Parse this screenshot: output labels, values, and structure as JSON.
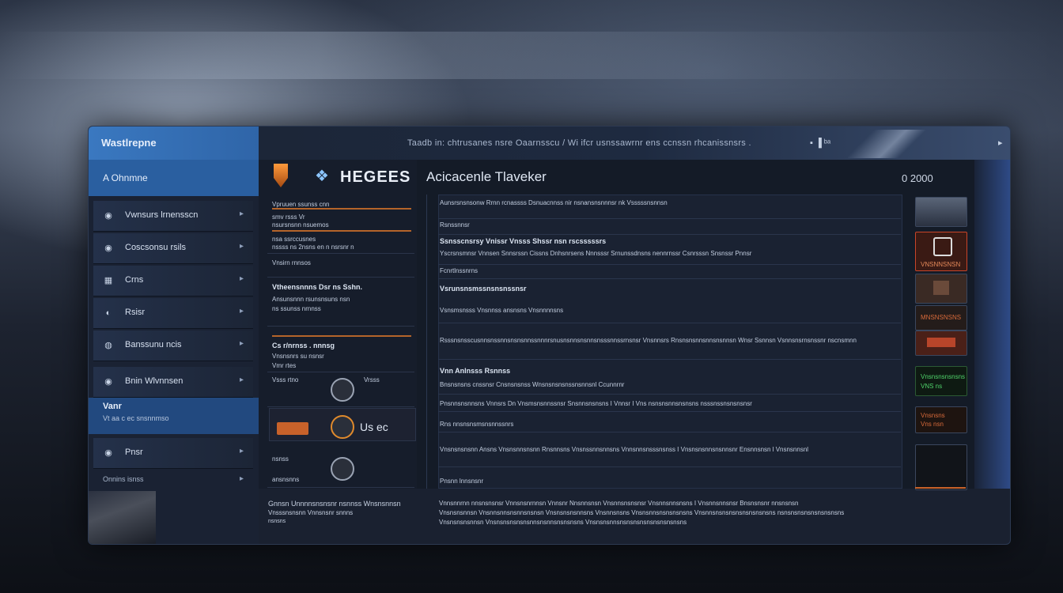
{
  "window": {
    "brand": "Wastlrepne",
    "title_text": "Taadb  in:  chtrusanes nsre Oaarnsscu /  Wi  ifcr usnssawrnr  ens  ccnssn  rhcanissnsrs .",
    "tb_icons": "▪  ▐ ᵇᵃ"
  },
  "sidebar": {
    "header": "A Ohnmne",
    "items": [
      {
        "icon": "◉",
        "label": "Vwnsurs lrnensscn"
      },
      {
        "icon": "◉",
        "label": "Coscsonsu rsils"
      },
      {
        "icon": "▦",
        "label": "Crns"
      },
      {
        "icon": "◐",
        "label": "Rsisr"
      },
      {
        "icon": "◍",
        "label": "Banssunu ncis"
      },
      {
        "icon": "◉",
        "label": "Bnin Wlvnnsen"
      }
    ],
    "highlight": {
      "title": "Vanr",
      "subtitle": "Vt  aa c ec snsnnmso"
    },
    "extra_items": [
      {
        "icon": "◉",
        "label": "Pnsr"
      }
    ],
    "last": "Onnins  isnss"
  },
  "header": {
    "logo_word": "HEGEES",
    "app_title": "Acicacenle Tlaveker",
    "counter": "0  2000"
  },
  "mid": {
    "block1": [
      "Vpruuen ssunss cnn",
      "smv  rsss  Vr",
      "nsursnsnn nsuemos",
      "nsa ssrccusnes",
      "nssss  ns  2nsns  en n nsrsnr n",
      "Vnsirn rnnsos"
    ],
    "block2_title": "Vtheensnnns Dsr ns Sshn.",
    "block2_lines": [
      "Ansunsnnn  rsunsnsuns  nsn",
      "ns  ssunss   nrnnss"
    ],
    "block3_title": "Cs  r/nrnss  .  nnnsg",
    "block3_lines": [
      "Vnsnsnrs su nsnsr",
      "Vmr rtes"
    ],
    "block4_left": "Vsss  rtno",
    "block4_right": "Vrsss",
    "orange_label": "Us ec",
    "block5_lines": [
      "nsnss",
      "ansnsnns"
    ]
  },
  "main": {
    "r1": "Aunsrsnsnsonw  Rrnn  rcnassss  Dsnuacnnss  nir  nsnansnsnnnsr  nk  Vsssssnsnnsn",
    "r2": "Rsnssnnsr",
    "r3_title": "Ssnsscnsrsy  Vnissr  Vnsss  Shssr   nsn rscsssssrs",
    "r3_sub": "Yscrsnsmnsr  Vnnsen  Snnsrssn  Cissns  Dnhsnrsens  Nnnsssr  Srnunssdnsns  nennrnssr  Csnrsssn  Snsnssr  Pnnsr",
    "r4": "Fcnrtlnssnrns",
    "r5_title": "Vsrunsnsmssnsnsnssnsr",
    "r5_sub": "Vsnsmsnsss  Vnsnnss  ansnsns  Vnsnnnnsns",
    "r6": "Rsssnsnsscusnnsnssnnsnsnsnnssnnnrsnusnsnnsnsnnsnsssnnssrnsnsr  Vnsnnsrs  Rnsnsnsnnsnnsnsnnsn  Wnsr Ssnnsn  Vsnnsnsrnsnssnr  nscnsmnn",
    "r7_title": "Vnn  Anlnsss  Rsnnss",
    "r7_sub": "Bnsnsnsns  cnssnsr  Cnsnsnsnss  Wnsnsnsnsnssnsnnsnl  Ccunnrnr",
    "r8": "Pnsnnsnsnnsns  Vnnsrs  Dn  Vnsmsnsnnssnsr  Snsnnsnsnsns  I  Vnnsr  I  Vns  nsnsnsnnsnsnsns  nsssnssnsnsnsnsr",
    "r9": "Rns  nnsnsnsmsnsnnssnrs",
    "r10": "Vnsnsnsnsnn  Ansns  Vnsnsnnsnsnn  Rnsnnsns  Vnsnssnnsnnsns  Vnnsnnsnsssnsnss  I  Vnsnsnsnnsnsnnsnr  Ensnnsnsn  l  Vnsnsnnsnl",
    "r11": "Pnsnn lnnsnsnr"
  },
  "footer": {
    "left_line1": "Gnnsn  Unnnnsnsnsnr  nsnnss  Wnsnsnnsn",
    "left_line2": "Vnsssnsnsnn  Vnnsnsnr  snnns",
    "left_line3": "nsnsns",
    "right_line1": "Vnnsnnrnn  nnsnsnsnsr  Vnnsnsnrnnsn  Vnnsnr  Nnsnnsnsn  Vnsnnsnsnsnsr  Vnsnnsnnsnsns  I  Vnsnnsnnsnsr  Bnsnsnsnr  nnsnsnsn",
    "right_line2": "Vnsnsnsnnsn  Vnsnnsnnsnsnnsnsnsn  Vnsnsnsnsnnsns  Vnsnnsnsns  Vnsnsnnsnsnsnsnsns  Vnsnnsnsnsnsnsnsnsnsnsns  nsnsnsnsnsnsnsnsnsns",
    "right_line3": "Vnsnsnsnsnnsn  Vnsnsnsnsnsnsnnsnsnnsnsnsnsns  Vnsnsnsnnsnsnsnsnsnsnsnsnsnsns"
  },
  "right_panel": {
    "thumb2_caption": "VNSNNSNSN",
    "thumb4_caption": "MNSNSNSNS",
    "thumb6_caption": "Vnsnsnsnsnsns",
    "thumb6_sub": "VNS  ns",
    "thumb7_caption": "Vnsnsns",
    "thumb7_sub": "Vns  nsn"
  },
  "colors": {
    "accent_blue": "#2f65a8",
    "accent_orange": "#c8622a",
    "accent_green": "#4fd36a",
    "accent_red": "#c8452a"
  }
}
